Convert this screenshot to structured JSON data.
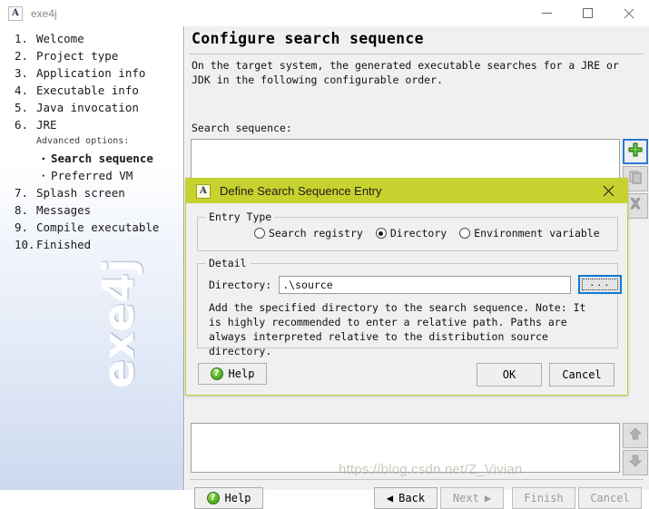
{
  "window": {
    "title": "exe4j",
    "icon": "app-icon",
    "minimize_label": "—",
    "maximize_label": "□",
    "close_label": "✕"
  },
  "sidebar": {
    "steps": [
      {
        "num": "1.",
        "label": "Welcome"
      },
      {
        "num": "2.",
        "label": "Project type"
      },
      {
        "num": "3.",
        "label": "Application info"
      },
      {
        "num": "4.",
        "label": "Executable info"
      },
      {
        "num": "5.",
        "label": "Java invocation"
      },
      {
        "num": "6.",
        "label": "JRE"
      }
    ],
    "advanced_options_label": "Advanced options:",
    "sub_steps": [
      {
        "bullet": "·",
        "label": "Search sequence",
        "active": true
      },
      {
        "bullet": "·",
        "label": "Preferred VM",
        "active": false
      }
    ],
    "steps_after": [
      {
        "num": "7.",
        "label": "Splash screen"
      },
      {
        "num": "8.",
        "label": "Messages"
      },
      {
        "num": "9.",
        "label": "Compile executable"
      },
      {
        "num": "10.",
        "label": "Finished"
      }
    ],
    "logo_watermark": "exe4j"
  },
  "main": {
    "page_title": "Configure search sequence",
    "description": "On the target system, the generated executable searches for a JRE or JDK in the following configurable order.",
    "field_label": "Search sequence:",
    "list_top_items": [],
    "list_bottom_items": [],
    "toolbar_top": [
      {
        "name": "add-entry-button",
        "icon": "plus-icon",
        "enabled": true,
        "focused": true
      },
      {
        "name": "duplicate-entry-button",
        "icon": "copy-icon",
        "enabled": false,
        "focused": false
      },
      {
        "name": "remove-entry-button",
        "icon": "close-x-icon",
        "enabled": false,
        "focused": false
      }
    ],
    "toolbar_bottom": [
      {
        "name": "move-up-button",
        "icon": "arrow-up-icon",
        "enabled": false
      },
      {
        "name": "move-down-button",
        "icon": "arrow-down-icon",
        "enabled": false
      }
    ],
    "buttons": {
      "help": "Help",
      "back": "Back",
      "back_arrow": "◀",
      "next": "Next",
      "next_arrow": "▶",
      "finish": "Finish",
      "cancel": "Cancel"
    }
  },
  "dialog": {
    "title": "Define Search Sequence Entry",
    "icon": "app-icon",
    "close_label": "✕",
    "entry_type": {
      "legend": "Entry Type",
      "options": [
        {
          "label": "Search registry",
          "selected": false
        },
        {
          "label": "Directory",
          "selected": true
        },
        {
          "label": "Environment variable",
          "selected": false
        }
      ]
    },
    "detail": {
      "legend": "Detail",
      "directory_label": "Directory:",
      "directory_value": ".\\source",
      "directory_placeholder": "",
      "browse_label": "...",
      "hint": "Add the specified directory to the search sequence. Note: It is highly recommended to enter a relative path. Paths are always interpreted relative to the distribution source directory."
    },
    "buttons": {
      "help": "Help",
      "ok": "OK",
      "cancel": "Cancel"
    }
  },
  "watermark": {
    "url": "https://blog.csdn.net/Z_Vivian"
  },
  "colors": {
    "dialog_titlebar": "#c7d22e",
    "focus_blue": "#0b7ad8",
    "panel_bg": "#f0f0f0",
    "sidebar_bottom": "#ccd9ee"
  }
}
